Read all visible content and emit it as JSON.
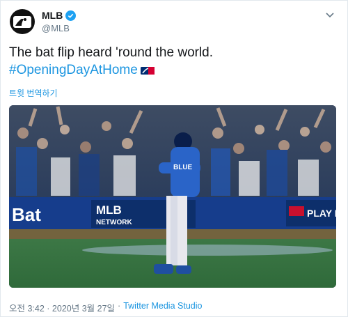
{
  "account": {
    "name": "MLB",
    "handle": "@MLB",
    "avatar_text": "MLB"
  },
  "tweet": {
    "text": "The bat flip heard 'round the world.",
    "hashtag": "#OpeningDayAtHome",
    "translate": "트윗 번역하기"
  },
  "media": {
    "board_left": "Bat",
    "board_center_1": "MLB",
    "board_center_2": "NETWORK",
    "board_right": "PLAY B",
    "jersey": "BLUE"
  },
  "meta": {
    "timestamp": "오전 3:42 · 2020년 3월 27일",
    "separator": "·",
    "source": "Twitter Media Studio"
  }
}
